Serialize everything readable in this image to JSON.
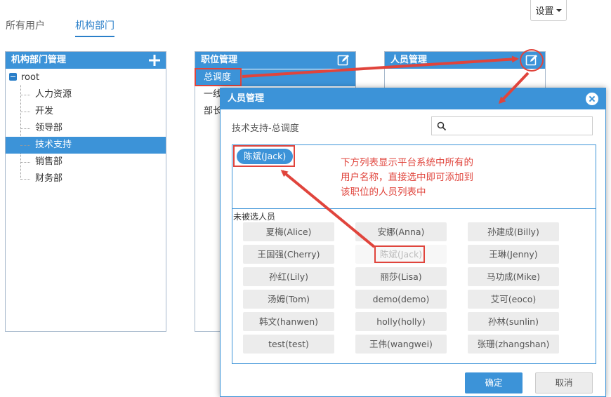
{
  "tabs": [
    "所有用户",
    "机构部门"
  ],
  "settings": {
    "label": "设置"
  },
  "dept_panel": {
    "title": "机构部门管理",
    "root": "root",
    "items": [
      "人力资源",
      "开发",
      "领导部",
      "技术支持",
      "销售部",
      "财务部"
    ],
    "selected": "技术支持"
  },
  "position_panel": {
    "title": "职位管理",
    "items": [
      "总调度",
      "一线",
      "部长"
    ],
    "selected": "总调度"
  },
  "staff_panel": {
    "title": "人员管理"
  },
  "modal": {
    "title": "人员管理",
    "context": "技术支持-总调度",
    "search_placeholder": "",
    "selected_users": [
      "陈斌(Jack)"
    ],
    "unselected_label": "未被选人员",
    "users": [
      "夏梅(Alice)",
      "安娜(Anna)",
      "孙建成(Billy)",
      "王国强(Cherry)",
      "陈斌(Jack)",
      "王琳(Jenny)",
      "孙红(Lily)",
      "丽莎(Lisa)",
      "马功成(Mike)",
      "汤姆(Tom)",
      "demo(demo)",
      "艾可(eoco)",
      "韩文(hanwen)",
      "holly(holly)",
      "孙林(sunlin)",
      "test(test)",
      "王伟(wangwei)",
      "张珊(zhangshan)"
    ],
    "taken_user": "陈斌(Jack)",
    "ok_label": "确定",
    "cancel_label": "取消"
  },
  "annotation": {
    "lines": [
      "下方列表显示平台系统中所有的",
      "用户名称，直接选中即可添加到",
      "该职位的人员列表中"
    ]
  },
  "colors": {
    "accent": "#3c93d8",
    "annotation": "#e0443c"
  }
}
